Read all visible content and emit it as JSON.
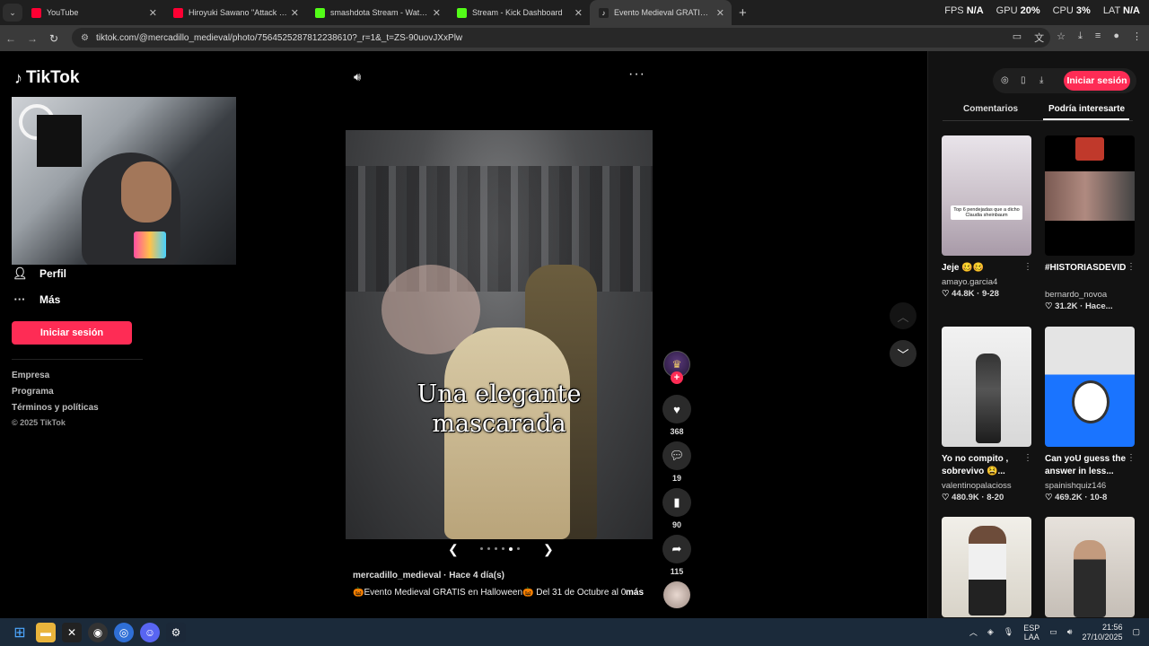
{
  "browser": {
    "tabs": [
      {
        "title": "YouTube",
        "color": "#ff0033",
        "active": false
      },
      {
        "title": "Hiroyuki Sawano \"Attack on Tit",
        "color": "#ff0033",
        "active": false
      },
      {
        "title": "smashdota Stream - Watch Live",
        "color": "#53fc18",
        "active": false
      },
      {
        "title": "Stream - Kick Dashboard",
        "color": "#53fc18",
        "active": false
      },
      {
        "title": "Evento Medieval GRATIS en",
        "color": "#25f4ee",
        "active": true
      }
    ],
    "url": "tiktok.com/@mercadillo_medieval/photo/7564525287812238610?_r=1&_t=ZS-90uovJXxPlw",
    "sysmon": {
      "fps_label": "FPS",
      "fps_value": "N/A",
      "gpu_label": "GPU",
      "gpu_value": "20%",
      "cpu_label": "CPU",
      "cpu_value": "3%",
      "lat_label": "LAT",
      "lat_value": "N/A"
    }
  },
  "sidebar": {
    "logo_text": "TikTok",
    "profile_label": "Perfil",
    "more_label": "Más",
    "login_label": "Iniciar sesión",
    "links": [
      "Empresa",
      "Programa",
      "Términos y políticas"
    ],
    "copyright": "© 2025 TikTok"
  },
  "post": {
    "caption_line1": "Una elegante",
    "caption_line2": "mascarada",
    "author_line": "mercadillo_medieval · Hace 4 día(s)",
    "description": "🎃Evento Medieval GRATIS en Halloween🎃 Del 31 de Octubre al 0...",
    "more_label": "más",
    "slides_total": 6,
    "slide_current": 5,
    "likes": "368",
    "comments": "19",
    "saves": "90",
    "shares": "115"
  },
  "right_panel": {
    "login_label": "Iniciar sesión",
    "tab_comments": "Comentarios",
    "tab_suggested": "Podría interesarte",
    "cards": [
      {
        "title": "Jeje 🥴🥴",
        "user": "amayo.garcia4",
        "stats": "♡ 44.8K · 9-28",
        "thumb_text": "Top 6 pendejadas que a dicho Claudia sheinbaum"
      },
      {
        "title": "#HISTORIASDEVIDA...",
        "user": "bernardo_novoa",
        "stats": "♡ 31.2K · Hace..."
      },
      {
        "title": "Yo no compito , sobrevivo 😫...",
        "user": "valentinopalacioss",
        "stats": "♡ 480.9K · 8-20"
      },
      {
        "title": "Can yoU guess the answer in less...",
        "user": "spainishquiz146",
        "stats": "♡ 469.2K · 10-8"
      }
    ]
  },
  "taskbar": {
    "lang_line1": "ESP",
    "lang_line2": "LAA",
    "time": "21:56",
    "date": "27/10/2025"
  },
  "colors": {
    "accent": "#fe2c55",
    "bg": "#000000",
    "panel": "#121212"
  }
}
